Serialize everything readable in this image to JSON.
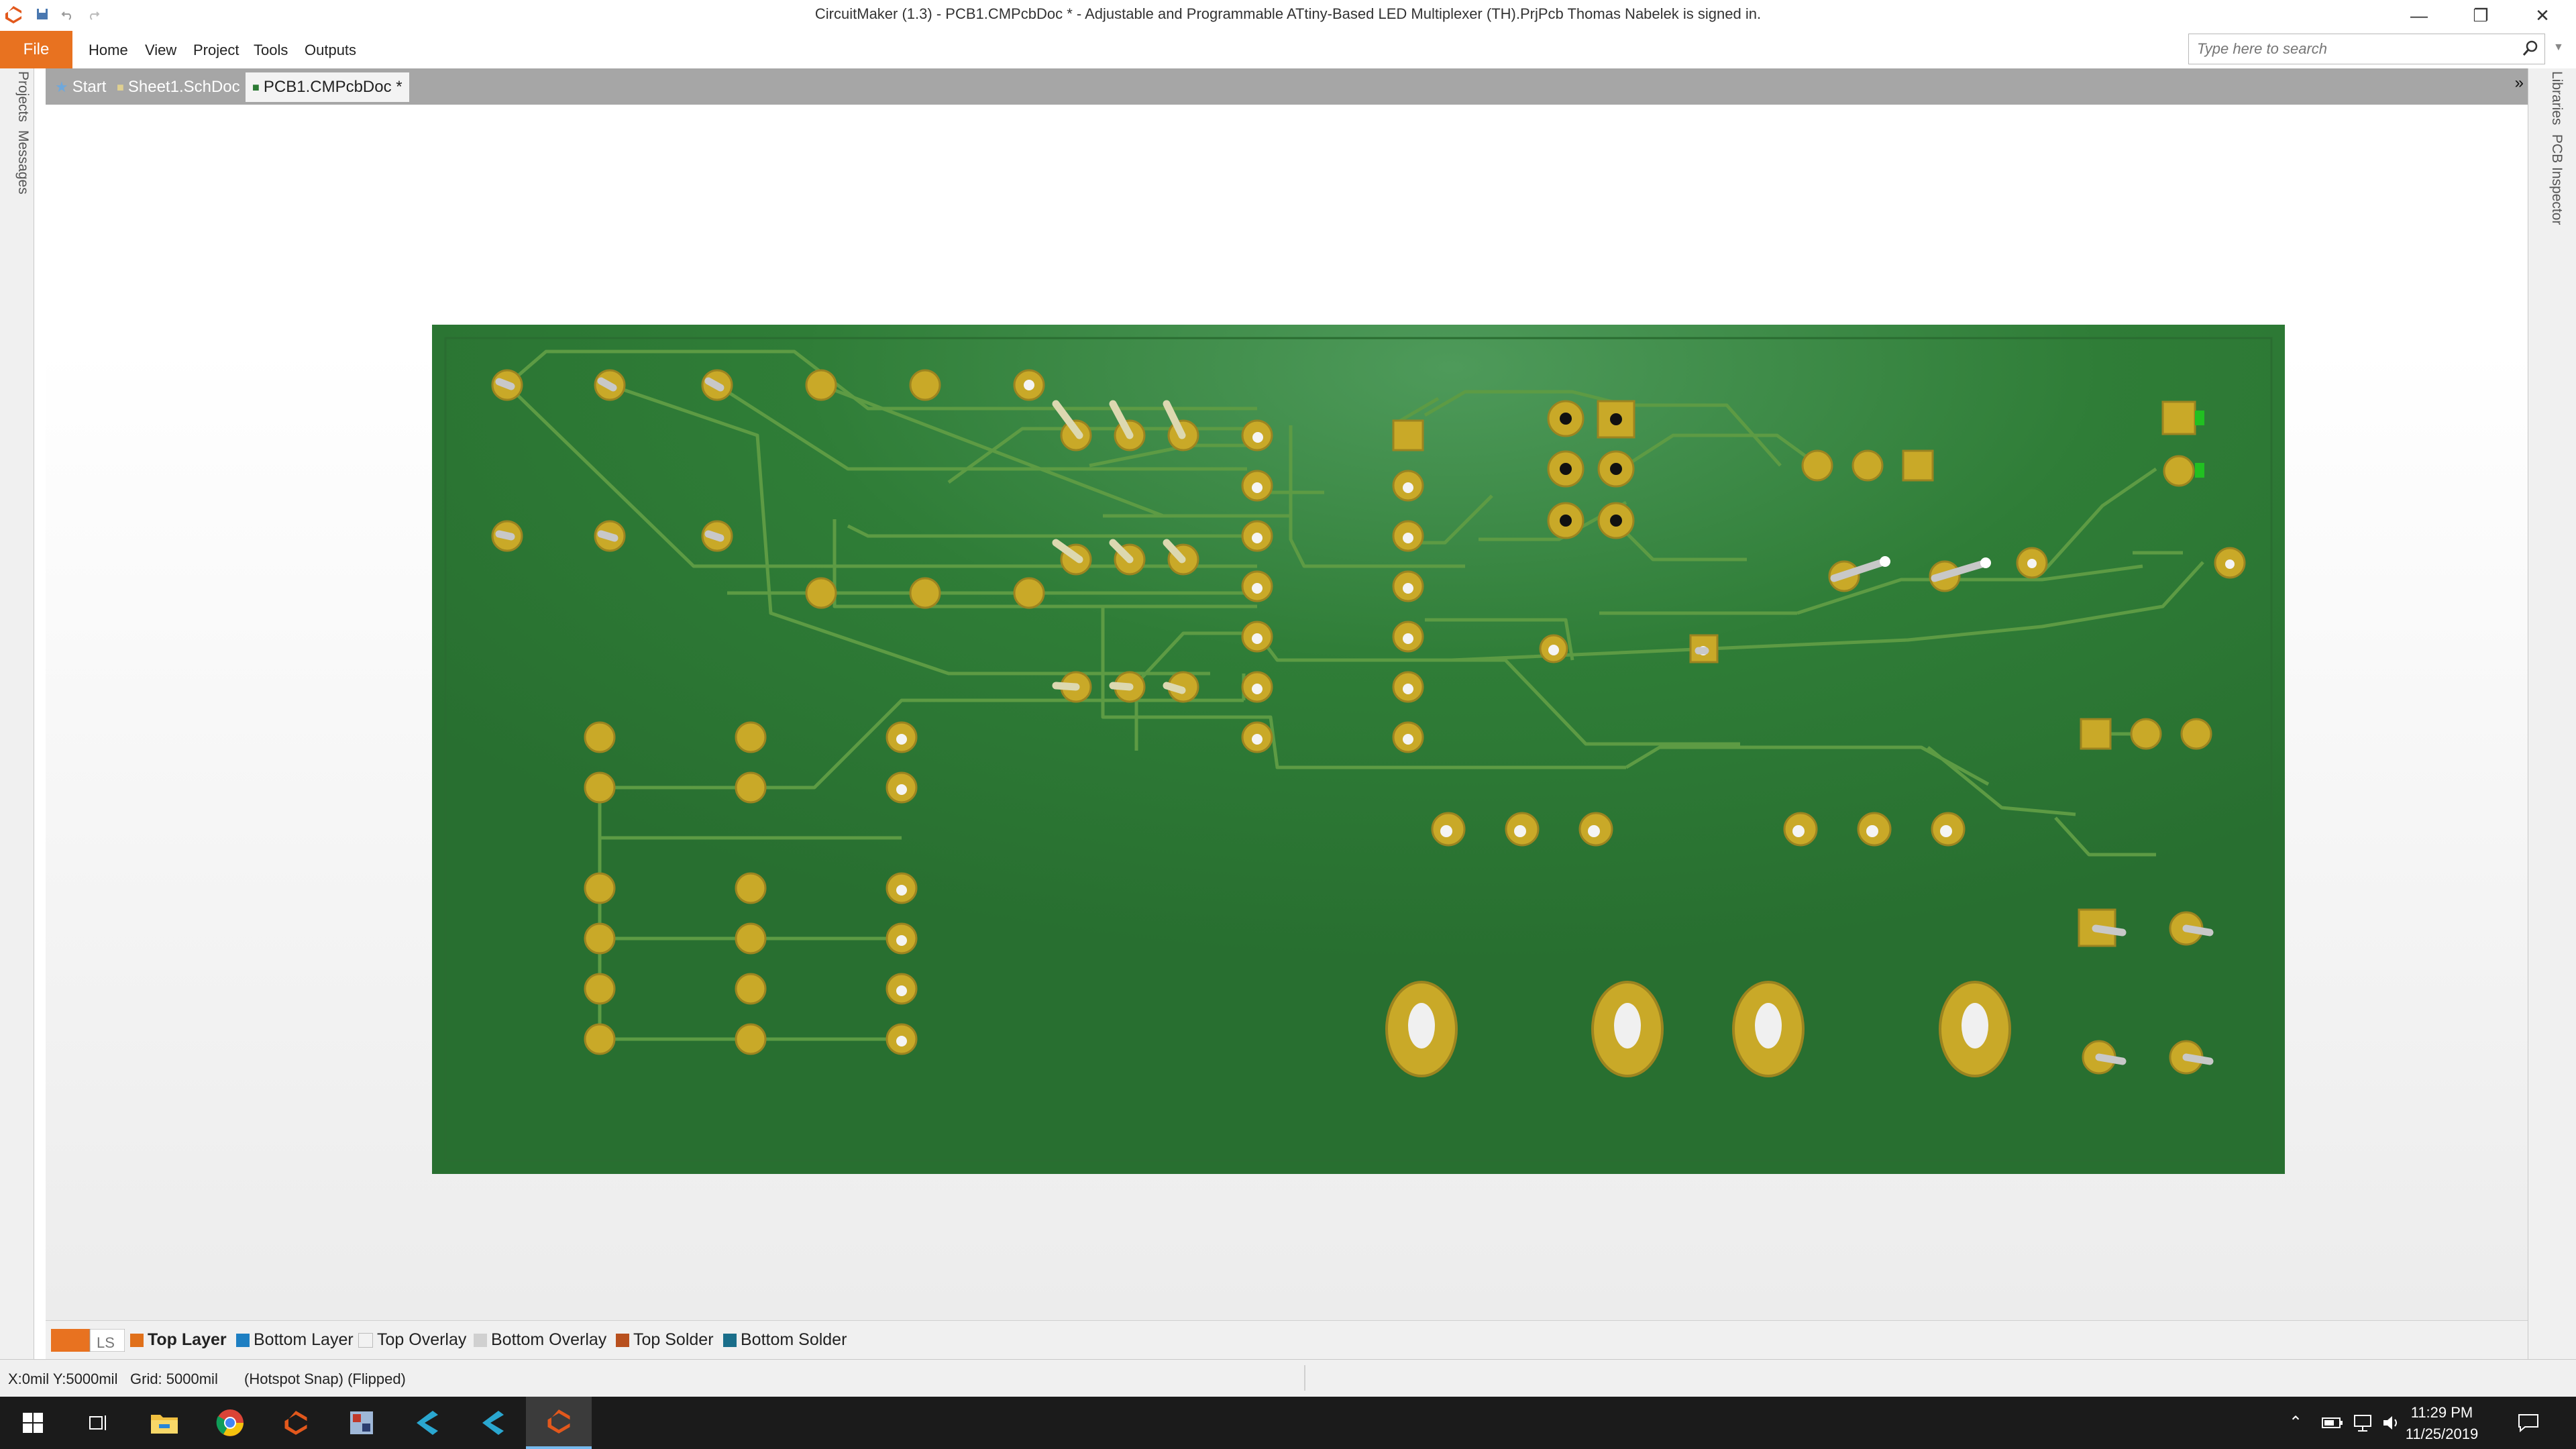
{
  "window": {
    "title": "CircuitMaker (1.3) - PCB1.CMPcbDoc * - Adjustable and Programmable ATtiny-Based LED Multiplexer (TH).PrjPcb Thomas Nabelek is signed in."
  },
  "menu": {
    "file": "File",
    "items": [
      "Home",
      "View",
      "Project",
      "Tools",
      "Outputs"
    ]
  },
  "search": {
    "placeholder": "Type here to search"
  },
  "left_panel": {
    "tabs": [
      "Projects",
      "Messages"
    ]
  },
  "right_panel": {
    "tabs": [
      "Libraries",
      "PCB Inspector"
    ]
  },
  "doc_tabs": [
    {
      "label": "Start"
    },
    {
      "label": "Sheet1.SchDoc"
    },
    {
      "label": "PCB1.CMPcbDoc *"
    }
  ],
  "layers": {
    "ls_label": "LS",
    "items": [
      {
        "label": "Top Layer",
        "color": "#e0701a"
      },
      {
        "label": "Bottom Layer",
        "color": "#1e7fc2"
      },
      {
        "label": "Top Overlay",
        "color": "#f2f2f2"
      },
      {
        "label": "Bottom Overlay",
        "color": "#d0d0d0"
      },
      {
        "label": "Top Solder",
        "color": "#b8501e"
      },
      {
        "label": "Bottom Solder",
        "color": "#1a6e8a"
      }
    ]
  },
  "status": {
    "coords": "X:0mil Y:5000mil",
    "grid": "Grid: 5000mil",
    "mode": "(Hotspot Snap) (Flipped)"
  },
  "taskbar": {
    "time": "11:29 PM",
    "date": "11/25/2019"
  },
  "colors": {
    "accent": "#e87220",
    "board": "#2c7a34",
    "pad": "#c8a828",
    "trace": "#5fa045"
  }
}
